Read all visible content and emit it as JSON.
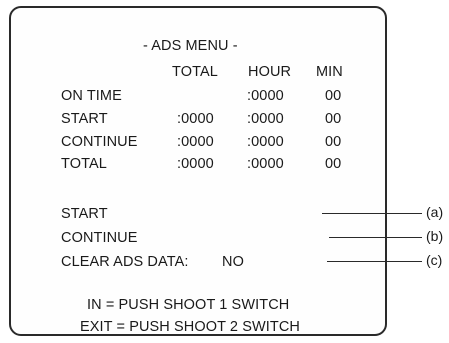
{
  "menu": {
    "title": "- ADS MENU -",
    "columns": [
      "TOTAL",
      "HOUR",
      "MIN"
    ],
    "rows": [
      {
        "label": "ON TIME",
        "total": "",
        "hour": ":0000",
        "min": "00"
      },
      {
        "label": "START",
        "total": ":0000",
        "hour": ":0000",
        "min": "00"
      },
      {
        "label": "CONTINUE",
        "total": ":0000",
        "hour": ":0000",
        "min": "00"
      },
      {
        "label": "TOTAL",
        "total": ":0000",
        "hour": ":0000",
        "min": "00"
      }
    ],
    "options": [
      {
        "label": "START",
        "value": "",
        "callout": "(a)"
      },
      {
        "label": "CONTINUE",
        "value": "",
        "callout": "(b)"
      },
      {
        "label": "CLEAR ADS DATA:",
        "value": "NO",
        "callout": "(c)"
      }
    ],
    "instructions": [
      "IN  =  PUSH SHOOT 1 SWITCH",
      "EXIT  =  PUSH SHOOT 2 SWITCH"
    ]
  }
}
